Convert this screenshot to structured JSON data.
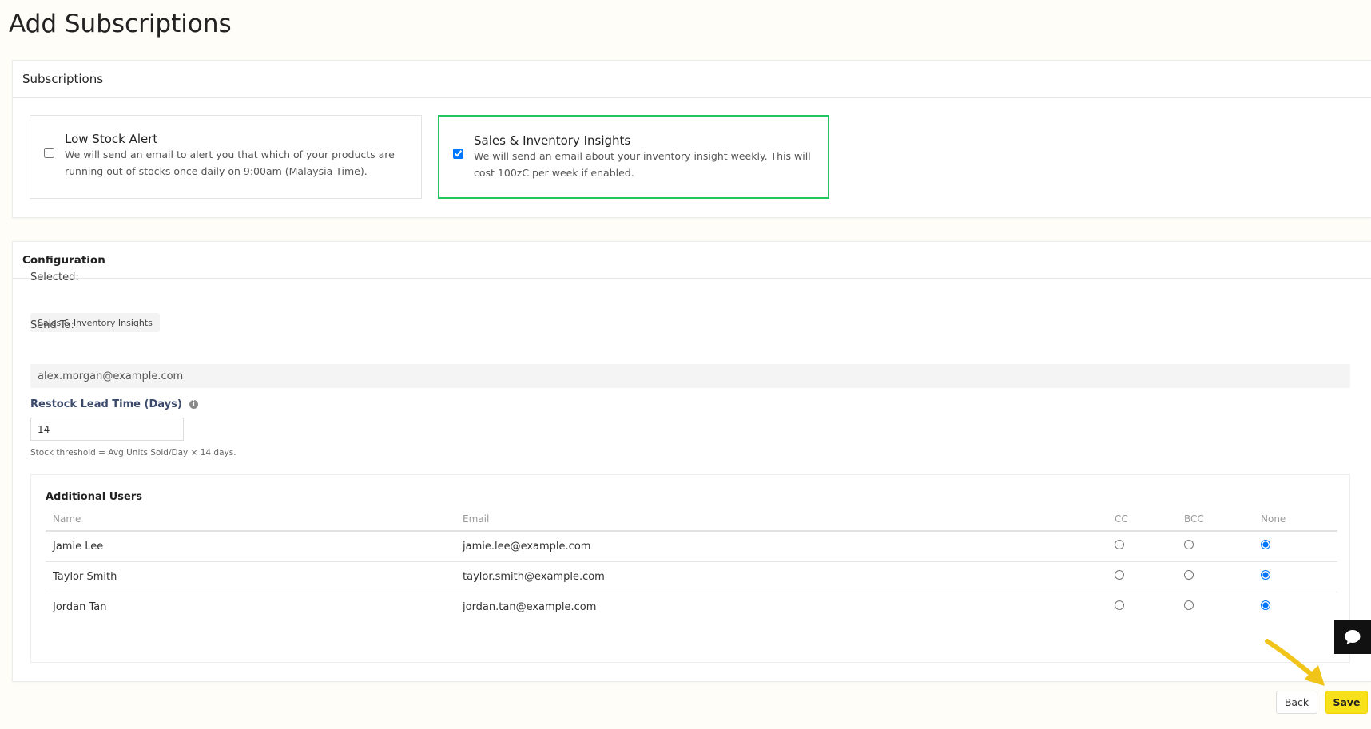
{
  "page": {
    "title": "Add Subscriptions"
  },
  "subscriptions": {
    "header": "Subscriptions",
    "options": [
      {
        "title": "Low Stock Alert",
        "description": "We will send an email to alert you that which of your products are running out of stocks once daily on 9:00am (Malaysia Time).",
        "checked": false
      },
      {
        "title": "Sales & Inventory Insights",
        "description": "We will send an email about your inventory insight weekly. This will cost 100zC per week if enabled.",
        "checked": true
      }
    ]
  },
  "configuration": {
    "header": "Configuration",
    "selected_label": "Selected:",
    "selected_chip": "Sales & Inventory Insights",
    "send_to_label": "Send To:",
    "send_to_value": "alex.morgan@example.com",
    "lead_time_label": "Restock Lead Time (Days)",
    "lead_time_value": "14",
    "hint": "Stock threshold = Avg Units Sold/Day × 14 days.",
    "additional_users": {
      "title": "Additional Users",
      "columns": [
        "Name",
        "Email",
        "CC",
        "BCC",
        "None"
      ],
      "rows": [
        {
          "name": "Jamie Lee",
          "email": "jamie.lee@example.com",
          "selection": "None"
        },
        {
          "name": "Taylor Smith",
          "email": "taylor.smith@example.com",
          "selection": "None"
        },
        {
          "name": "Jordan Tan",
          "email": "jordan.tan@example.com",
          "selection": "None"
        }
      ]
    }
  },
  "actions": {
    "back_label": "Back",
    "save_label": "Save"
  },
  "icons": {
    "chat": "chat-bubble-icon",
    "info": "info-icon",
    "pointer": "arrow-pointer-icon"
  },
  "colors": {
    "selected_border": "#22c55e",
    "save_button": "#f8e11a",
    "radio_checked": "#1a73e8"
  }
}
